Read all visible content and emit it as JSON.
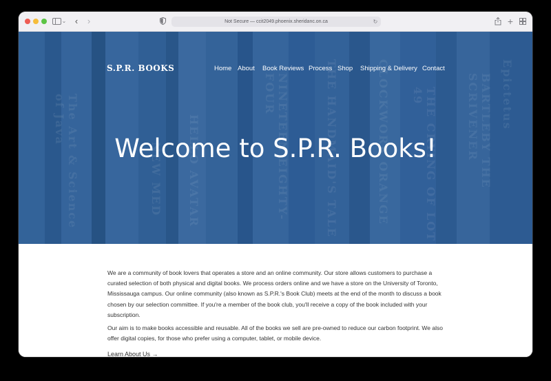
{
  "browser": {
    "url_text": "Not Secure — ccit2049.phoenix.sheridanc.on.ca"
  },
  "site": {
    "brand": "S.P.R. BOOKS",
    "nav": [
      "Home",
      "About",
      "Book Reviews",
      "Process",
      "Shop",
      "Shipping & Delivery",
      "Contact"
    ]
  },
  "hero": {
    "title": "Welcome to S.P.R. Books!"
  },
  "content": {
    "paragraph1": "We are a community of book lovers that operates a store and an online community. Our store allows customers to purchase a curated selection of both physical and digital books. We process orders online and we have a store on the University of Toronto, Mississauga campus. Our online community (also known as S.P.R.'s Book Club) meets at the end of the month to discuss a book chosen by our selection committee. If you're a member of the book club, you'll receive a copy of the book included with your subscription.",
    "paragraph2": "Our aim is to make books accessible and reusable. All of the books we sell are pre-owned to reduce our carbon footprint. We also offer digital copies, for those who prefer using a computer, tablet, or mobile device.",
    "learn_link": "Learn About Us →"
  },
  "icons": {
    "traffic_lights": [
      "close",
      "minimize",
      "zoom"
    ],
    "toolbar": [
      "sidebar-icon",
      "chevron-down-icon",
      "back-icon",
      "forward-icon",
      "shield-icon",
      "reload-icon",
      "share-icon",
      "new-tab-icon",
      "tab-overview-icon"
    ]
  }
}
